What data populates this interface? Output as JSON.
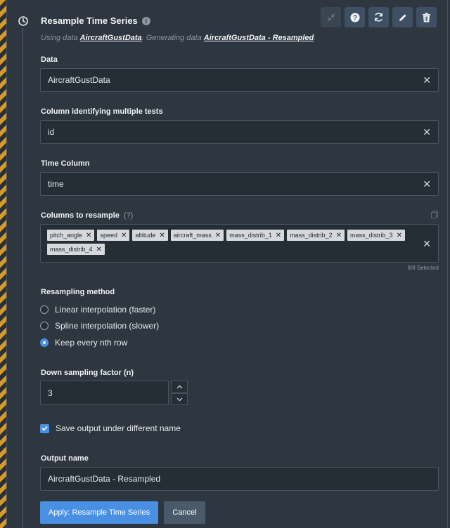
{
  "header": {
    "title": "Resample Time Series",
    "subtitle_prefix": "Using data",
    "input_dataset": "AircraftGustData",
    "subtitle_middle": ". Generating data",
    "output_dataset": "AircraftGustData - Resampled",
    "subtitle_end": "."
  },
  "toolbar": {
    "icons": [
      "collapse-icon",
      "help-icon",
      "refresh-icon",
      "edit-icon",
      "delete-icon"
    ]
  },
  "fields": {
    "data": {
      "label": "Data",
      "value": "AircraftGustData"
    },
    "tests_column": {
      "label": "Column identifying multiple tests",
      "value": "id"
    },
    "time_column": {
      "label": "Time Column",
      "value": "time"
    },
    "resample_columns": {
      "label": "Columns to resample",
      "help": "(?)",
      "tags": [
        "pitch_angle",
        "speed",
        "altitude",
        "aircraft_mass",
        "mass_distrib_1",
        "mass_distrib_2",
        "mass_distrib_3",
        "mass_distrib_4"
      ],
      "selected_count": "8/8 Selected"
    }
  },
  "resampling": {
    "label": "Resampling method",
    "options": [
      {
        "label": "Linear interpolation (faster)",
        "selected": false
      },
      {
        "label": "Spline interpolation (slower)",
        "selected": false
      },
      {
        "label": "Keep every nth row",
        "selected": true
      }
    ]
  },
  "downsampling": {
    "label": "Down sampling factor (n)",
    "value": "3"
  },
  "save_output": {
    "label": "Save output under different name",
    "checked": true
  },
  "output_name": {
    "label": "Output name",
    "value": "AircraftGustData - Resampled"
  },
  "actions": {
    "apply_label": "Apply: Resample Time Series",
    "cancel_label": "Cancel"
  },
  "colors": {
    "accent": "#4a90e2",
    "background": "#2e3640",
    "field_bg": "#252d35",
    "stripe": "#d39a2c"
  }
}
